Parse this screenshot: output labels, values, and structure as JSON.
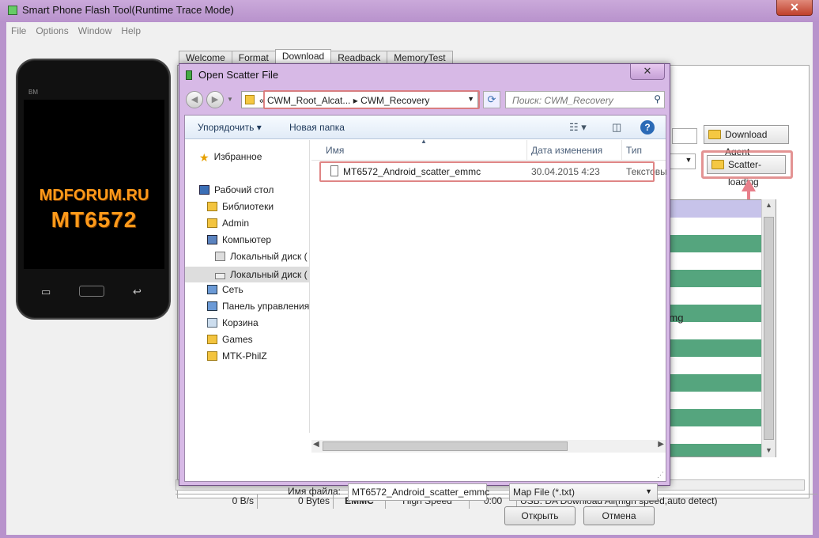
{
  "window": {
    "title": "Smart Phone Flash Tool(Runtime Trace Mode)",
    "close_glyph": "✕"
  },
  "menu": [
    "File",
    "Options",
    "Window",
    "Help"
  ],
  "phone": {
    "brand": "BM",
    "line1": "MDFORUM.RU",
    "line2": "MT6572",
    "menu_key": "▭",
    "back_key": "↩"
  },
  "tabs": [
    "Welcome",
    "Format",
    "Download",
    "Readback",
    "MemoryTest"
  ],
  "active_tab": "Download",
  "buttons": {
    "download_agent": "Download Agent",
    "scatter_loading": "Scatter-loading"
  },
  "partition_list": {
    "partial_text": "ry.img",
    "stripes": [
      "w",
      "g",
      "w",
      "g",
      "w",
      "g",
      "w",
      "g",
      "w",
      "g",
      "w",
      "g",
      "w",
      "g"
    ]
  },
  "status": {
    "speed": "0 B/s",
    "bytes": "0 Bytes",
    "storage": "EMMC",
    "mode": "High Speed",
    "time": "0:00",
    "message": "USB: DA Download All(high speed,auto detect)"
  },
  "dialog": {
    "title": "Open Scatter File",
    "close_glyph": "✕",
    "nav": {
      "back": "◀",
      "forward": "▶",
      "dropdown": "▼"
    },
    "address": {
      "text": "«  CWM_Root_Alcat...  ▸  CWM_Recovery",
      "caret": "▼"
    },
    "refresh_glyph": "⟳",
    "search": {
      "placeholder": "Поиск: CWM_Recovery",
      "icon_glyph": "⚲"
    },
    "commands": {
      "organize": "Упорядочить ▾",
      "new_folder": "Новая папка",
      "view_glyph": "☷  ▾",
      "pane_glyph": "◫",
      "help_glyph": "?"
    },
    "nav_items": [
      {
        "label": "Избранное",
        "icon": "star-icon"
      },
      {
        "label": "Рабочий стол",
        "icon": "desktop-icon"
      },
      {
        "label": "Библиотеки",
        "icon": "library-icon"
      },
      {
        "label": "Admin",
        "icon": "user-folder-icon"
      },
      {
        "label": "Компьютер",
        "icon": "computer-icon"
      },
      {
        "label": "Локальный диск (",
        "icon": "drive-windows-icon"
      },
      {
        "label": "Локальный диск (",
        "icon": "drive-icon"
      },
      {
        "label": "Сеть",
        "icon": "network-icon"
      },
      {
        "label": "Панель управления",
        "icon": "control-panel-icon"
      },
      {
        "label": "Корзина",
        "icon": "recycle-bin-icon"
      },
      {
        "label": "Games",
        "icon": "folder-icon"
      },
      {
        "label": "MTK-PhilZ",
        "icon": "folder-icon"
      }
    ],
    "columns": {
      "name": "Имя",
      "date": "Дата изменения",
      "type": "Тип"
    },
    "files": [
      {
        "name": "MT6572_Android_scatter_emmc",
        "date": "30.04.2015 4:23",
        "type": "Текстовы"
      }
    ],
    "scroll": {
      "left": "◀",
      "right": "▶"
    },
    "filename_label": "Имя файла:",
    "filename_value": "MT6572_Android_scatter_emmc",
    "filetype_value": "Map File (*.txt)",
    "open_button": "Открыть",
    "cancel_button": "Отмена",
    "grip_glyph": "⋰"
  },
  "colors": {
    "accent_frame": "#b893cc",
    "highlight": "#dc7878",
    "stripe_green": "#55a57e",
    "list_header": "#c7c3ea",
    "brand_orange": "#ff9a1a"
  }
}
